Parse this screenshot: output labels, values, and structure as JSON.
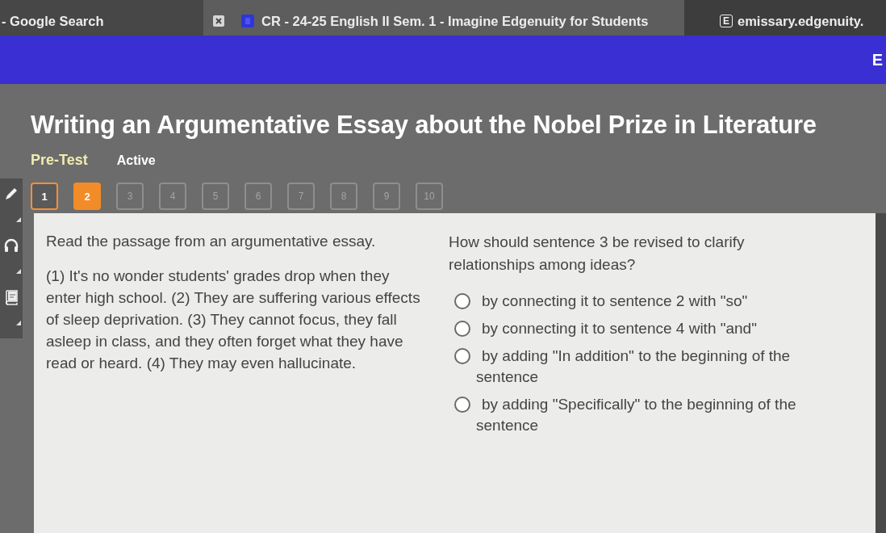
{
  "browser_tabs": [
    {
      "title": "- Google Search",
      "selected": false,
      "kind": "plain"
    },
    {
      "title": "CR - 24-25 English II Sem. 1 - Imagine Edgenuity for Students",
      "selected": true,
      "kind": "course"
    },
    {
      "title": "emissary.edgenuity.",
      "selected": false,
      "kind": "site",
      "icon_letter": "E"
    }
  ],
  "header_bar": {
    "logo": "E"
  },
  "activity": {
    "title": "Writing an Argumentative Essay about the Nobel Prize in Literature",
    "type": "Pre-Test",
    "status": "Active"
  },
  "question_nav": [
    {
      "label": "1",
      "selected": false,
      "visited": true
    },
    {
      "label": "2",
      "selected": true,
      "visited": true
    },
    {
      "label": "3",
      "selected": false,
      "visited": false
    },
    {
      "label": "4",
      "selected": false,
      "visited": false
    },
    {
      "label": "5",
      "selected": false,
      "visited": false
    },
    {
      "label": "6",
      "selected": false,
      "visited": false
    },
    {
      "label": "7",
      "selected": false,
      "visited": false
    },
    {
      "label": "8",
      "selected": false,
      "visited": false
    },
    {
      "label": "9",
      "selected": false,
      "visited": false
    },
    {
      "label": "10",
      "selected": false,
      "visited": false
    }
  ],
  "passage": {
    "instruction": "Read the passage from an argumentative essay.",
    "text": "(1) It's no wonder students' grades drop when they enter high school. (2) They are suffering various effects of sleep deprivation. (3) They cannot focus, they fall asleep in class, and they often forget what they have read or heard. (4) They may even hallucinate."
  },
  "question": {
    "prompt": "How should sentence 3 be revised to clarify relationships among ideas?",
    "options": [
      {
        "text": "by connecting it to sentence 2 with \"so\"",
        "selected": false
      },
      {
        "text": "by connecting it to sentence 4 with \"and\"",
        "selected": false
      },
      {
        "text": "by adding \"In addition\" to the beginning of the sentence",
        "selected": false
      },
      {
        "text": "by adding \"Specifically\" to the beginning of the sentence",
        "selected": false
      }
    ]
  }
}
